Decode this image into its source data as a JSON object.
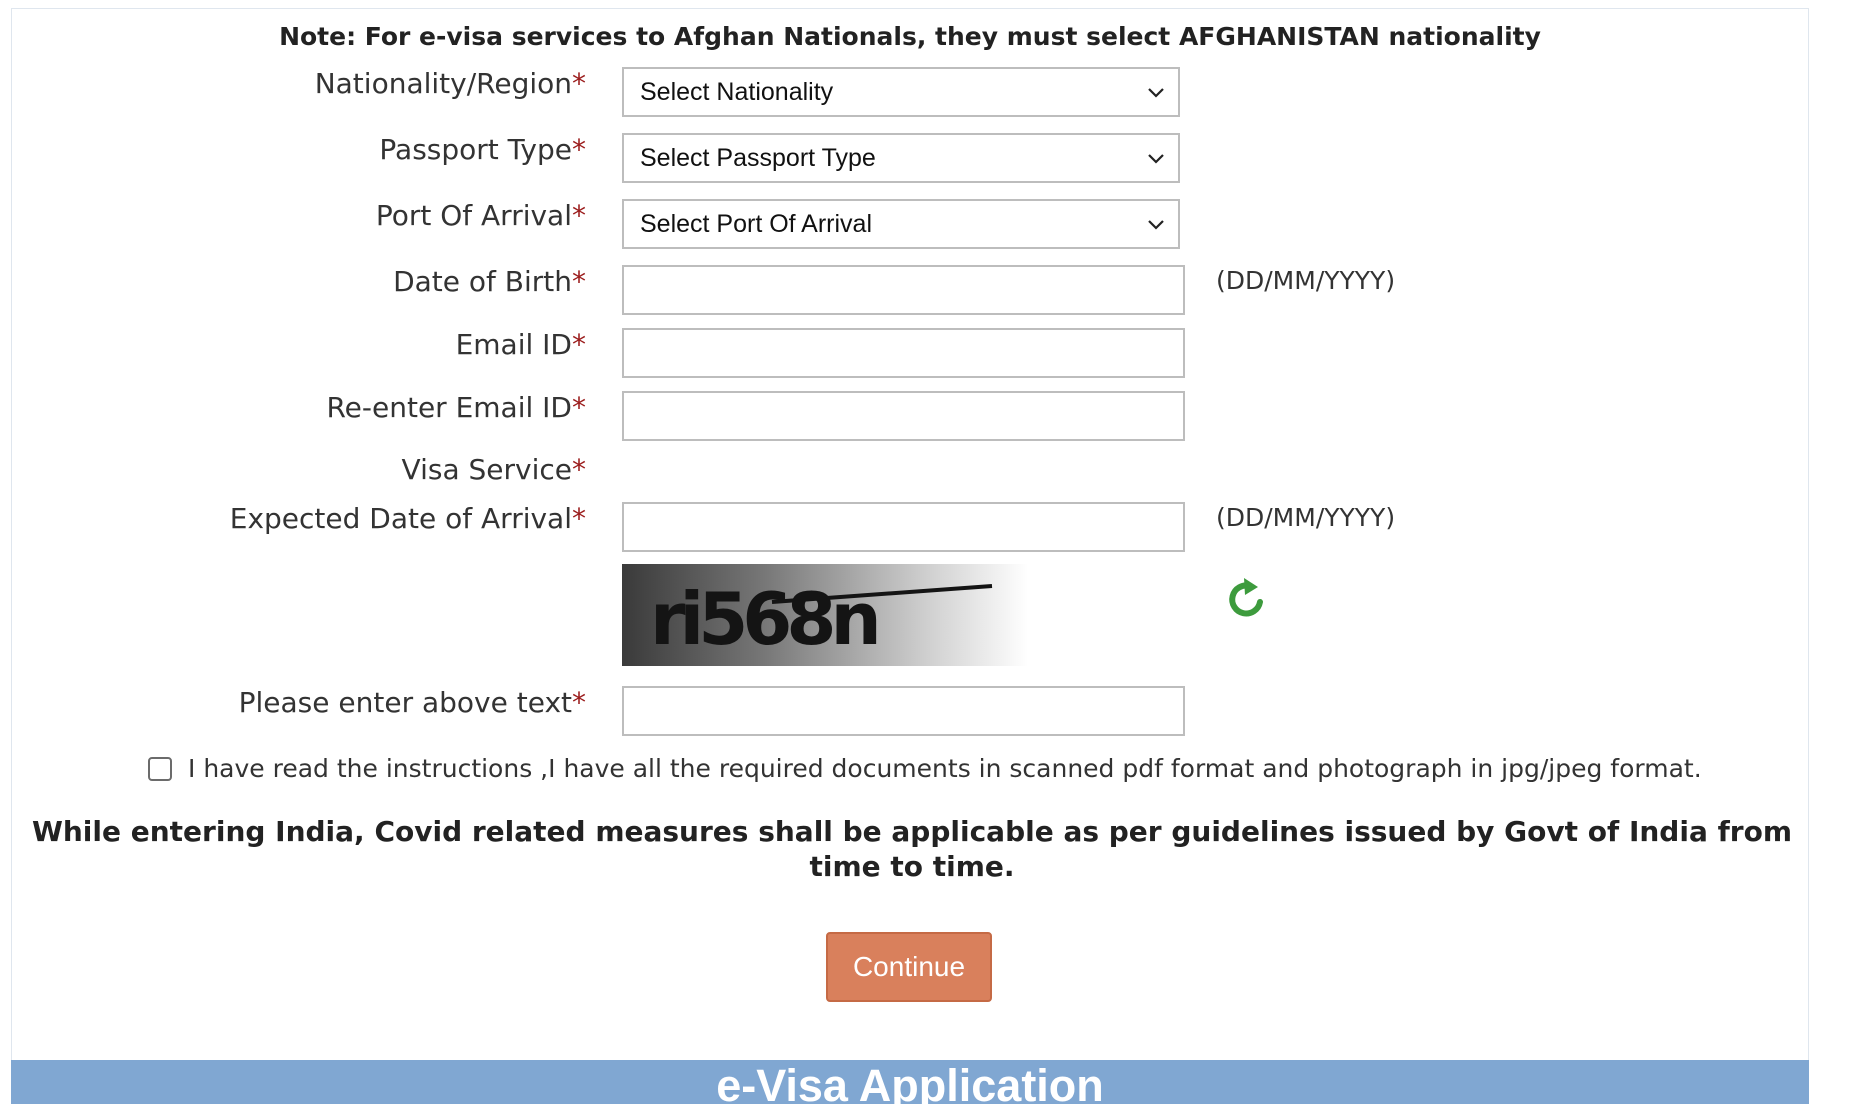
{
  "note": "Note: For e-visa services to Afghan Nationals, they must select AFGHANISTAN nationality",
  "required_mark": "*",
  "form": {
    "nationality": {
      "label": "Nationality/Region",
      "selected": "Select Nationality"
    },
    "passport_type": {
      "label": "Passport Type",
      "selected": "Select Passport Type"
    },
    "port_of_arrival": {
      "label": "Port Of Arrival",
      "selected": "Select Port Of Arrival"
    },
    "date_of_birth": {
      "label": "Date of Birth",
      "value": "",
      "hint": "(DD/MM/YYYY)"
    },
    "email": {
      "label": "Email ID",
      "value": ""
    },
    "reenter_email": {
      "label": "Re-enter Email ID",
      "value": ""
    },
    "visa_service": {
      "label": "Visa Service"
    },
    "expected_arrival": {
      "label": "Expected Date of Arrival",
      "value": "",
      "hint": "(DD/MM/YYYY)"
    },
    "captcha": {
      "text": "ri568n",
      "refresh_icon": "refresh-icon"
    },
    "captcha_entry": {
      "label": "Please enter above text",
      "value": ""
    }
  },
  "agreement": {
    "checked": false,
    "text": "I have read the instructions ,I have all the required documents in scanned pdf format and photograph in jpg/jpeg format."
  },
  "covid_notice": "While entering India, Covid related measures shall be applicable as per guidelines issued by Govt of India from time to time.",
  "continue_label": "Continue",
  "banner_title": "e-Visa Application",
  "colors": {
    "accent_button": "#d9805c",
    "banner": "#80a7d2",
    "required": "#9b1c1c",
    "refresh": "#3d9b3d"
  }
}
